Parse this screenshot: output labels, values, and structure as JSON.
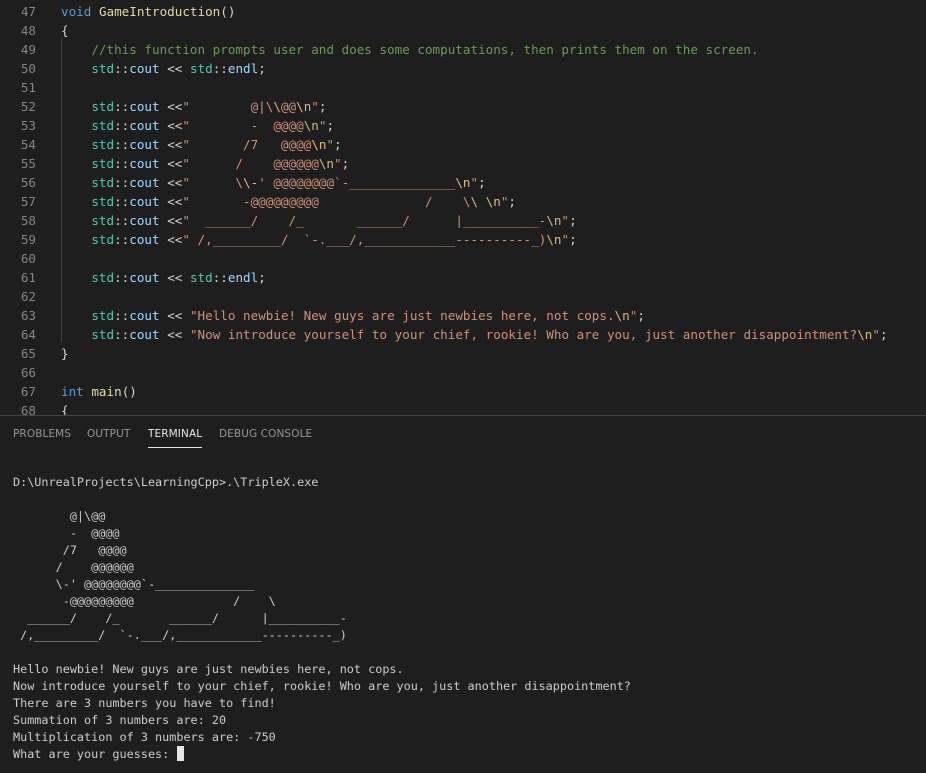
{
  "editor": {
    "lines": [
      {
        "n": "47",
        "tokens": [
          [
            "kw",
            "void"
          ],
          [
            "op",
            " "
          ],
          [
            "fn",
            "GameIntroduction"
          ],
          [
            "op",
            "()"
          ]
        ]
      },
      {
        "n": "48",
        "tokens": [
          [
            "op",
            "{"
          ]
        ]
      },
      {
        "n": "49",
        "tokens": [
          [
            "op",
            "    "
          ],
          [
            "cm",
            "//this function prompts user and does some computations, then prints them on the screen."
          ]
        ]
      },
      {
        "n": "50",
        "tokens": [
          [
            "op",
            "    "
          ],
          [
            "ns",
            "std"
          ],
          [
            "op",
            "::"
          ],
          [
            "id",
            "cout"
          ],
          [
            "op",
            " << "
          ],
          [
            "ns",
            "std"
          ],
          [
            "op",
            "::"
          ],
          [
            "id",
            "endl"
          ],
          [
            "op",
            ";"
          ]
        ]
      },
      {
        "n": "51",
        "tokens": []
      },
      {
        "n": "52",
        "tokens": [
          [
            "op",
            "    "
          ],
          [
            "ns",
            "std"
          ],
          [
            "op",
            "::"
          ],
          [
            "id",
            "cout"
          ],
          [
            "op",
            " <<"
          ],
          [
            "str",
            "\"        @|\\"
          ],
          [
            "esc",
            "\\"
          ],
          [
            "str",
            "@@"
          ],
          [
            "esc",
            "\\n"
          ],
          [
            "str",
            "\""
          ],
          [
            "op",
            ";"
          ]
        ]
      },
      {
        "n": "53",
        "tokens": [
          [
            "op",
            "    "
          ],
          [
            "ns",
            "std"
          ],
          [
            "op",
            "::"
          ],
          [
            "id",
            "cout"
          ],
          [
            "op",
            " <<"
          ],
          [
            "str",
            "\"        -  @@@@"
          ],
          [
            "esc",
            "\\n"
          ],
          [
            "str",
            "\""
          ],
          [
            "op",
            ";"
          ]
        ]
      },
      {
        "n": "54",
        "tokens": [
          [
            "op",
            "    "
          ],
          [
            "ns",
            "std"
          ],
          [
            "op",
            "::"
          ],
          [
            "id",
            "cout"
          ],
          [
            "op",
            " <<"
          ],
          [
            "str",
            "\"       /7   @@@@"
          ],
          [
            "esc",
            "\\n"
          ],
          [
            "str",
            "\""
          ],
          [
            "op",
            ";"
          ]
        ]
      },
      {
        "n": "55",
        "tokens": [
          [
            "op",
            "    "
          ],
          [
            "ns",
            "std"
          ],
          [
            "op",
            "::"
          ],
          [
            "id",
            "cout"
          ],
          [
            "op",
            " <<"
          ],
          [
            "str",
            "\"      /    @@@@@@"
          ],
          [
            "esc",
            "\\n"
          ],
          [
            "str",
            "\""
          ],
          [
            "op",
            ";"
          ]
        ]
      },
      {
        "n": "56",
        "tokens": [
          [
            "op",
            "    "
          ],
          [
            "ns",
            "std"
          ],
          [
            "op",
            "::"
          ],
          [
            "id",
            "cout"
          ],
          [
            "op",
            " <<"
          ],
          [
            "str",
            "\"      \\"
          ],
          [
            "esc",
            "\\-"
          ],
          [
            "str",
            "' @@@@@@@@`-______________"
          ],
          [
            "esc",
            "\\n"
          ],
          [
            "str",
            "\""
          ],
          [
            "op",
            ";"
          ]
        ]
      },
      {
        "n": "57",
        "tokens": [
          [
            "op",
            "    "
          ],
          [
            "ns",
            "std"
          ],
          [
            "op",
            "::"
          ],
          [
            "id",
            "cout"
          ],
          [
            "op",
            " <<"
          ],
          [
            "str",
            "\"       -@@@@@@@@@              /    \\"
          ],
          [
            "esc",
            "\\ "
          ],
          [
            "esc",
            "\\n"
          ],
          [
            "str",
            "\""
          ],
          [
            "op",
            ";"
          ]
        ]
      },
      {
        "n": "58",
        "tokens": [
          [
            "op",
            "    "
          ],
          [
            "ns",
            "std"
          ],
          [
            "op",
            "::"
          ],
          [
            "id",
            "cout"
          ],
          [
            "op",
            " <<"
          ],
          [
            "str",
            "\"  ______/    /_       ______/      |__________-"
          ],
          [
            "esc",
            "\\n"
          ],
          [
            "str",
            "\""
          ],
          [
            "op",
            ";"
          ]
        ]
      },
      {
        "n": "59",
        "tokens": [
          [
            "op",
            "    "
          ],
          [
            "ns",
            "std"
          ],
          [
            "op",
            "::"
          ],
          [
            "id",
            "cout"
          ],
          [
            "op",
            " <<"
          ],
          [
            "str",
            "\" /,_________/  `-.___/,____________----------_)"
          ],
          [
            "esc",
            "\\n"
          ],
          [
            "str",
            "\""
          ],
          [
            "op",
            ";"
          ]
        ]
      },
      {
        "n": "60",
        "tokens": []
      },
      {
        "n": "61",
        "tokens": [
          [
            "op",
            "    "
          ],
          [
            "ns",
            "std"
          ],
          [
            "op",
            "::"
          ],
          [
            "id",
            "cout"
          ],
          [
            "op",
            " << "
          ],
          [
            "ns",
            "std"
          ],
          [
            "op",
            "::"
          ],
          [
            "id",
            "endl"
          ],
          [
            "op",
            ";"
          ]
        ]
      },
      {
        "n": "62",
        "tokens": []
      },
      {
        "n": "63",
        "tokens": [
          [
            "op",
            "    "
          ],
          [
            "ns",
            "std"
          ],
          [
            "op",
            "::"
          ],
          [
            "id",
            "cout"
          ],
          [
            "op",
            " << "
          ],
          [
            "str",
            "\"Hello newbie! New guys are just newbies here, not cops."
          ],
          [
            "esc",
            "\\n"
          ],
          [
            "str",
            "\""
          ],
          [
            "op",
            ";"
          ]
        ]
      },
      {
        "n": "64",
        "tokens": [
          [
            "op",
            "    "
          ],
          [
            "ns",
            "std"
          ],
          [
            "op",
            "::"
          ],
          [
            "id",
            "cout"
          ],
          [
            "op",
            " << "
          ],
          [
            "str",
            "\"Now introduce yourself to your chief, rookie! Who are you, just another disappointment?"
          ],
          [
            "esc",
            "\\n"
          ],
          [
            "str",
            "\""
          ],
          [
            "op",
            ";"
          ]
        ]
      },
      {
        "n": "65",
        "tokens": [
          [
            "op",
            "}"
          ]
        ]
      },
      {
        "n": "66",
        "tokens": []
      },
      {
        "n": "67",
        "tokens": [
          [
            "kw",
            "int"
          ],
          [
            "op",
            " "
          ],
          [
            "fn",
            "main"
          ],
          [
            "op",
            "()"
          ]
        ]
      },
      {
        "n": "68",
        "tokens": [
          [
            "op",
            "{"
          ]
        ]
      }
    ]
  },
  "panel": {
    "tabs": [
      {
        "id": "problems",
        "label": "PROBLEMS"
      },
      {
        "id": "output",
        "label": "OUTPUT"
      },
      {
        "id": "terminal",
        "label": "TERMINAL"
      },
      {
        "id": "debug-console",
        "label": "DEBUG CONSOLE"
      }
    ],
    "active_tab": "terminal"
  },
  "terminal": {
    "command_line": "D:\\UnrealProjects\\LearningCpp>.\\TripleX.exe",
    "ascii_art": [
      "        @|\\@@",
      "        -  @@@@",
      "       /7   @@@@",
      "      /    @@@@@@",
      "      \\-' @@@@@@@@`-______________",
      "       -@@@@@@@@@              /    \\",
      "  ______/    /_       ______/      |__________-",
      " /,_________/  `-.___/,____________----------_)"
    ],
    "output_lines": [
      "Hello newbie! New guys are just newbies here, not cops.",
      "Now introduce yourself to your chief, rookie! Who are you, just another disappointment?",
      "There are 3 numbers you have to find!",
      "Summation of 3 numbers are: 20",
      "Multiplication of 3 numbers are: -750",
      "What are your guesses: "
    ]
  }
}
